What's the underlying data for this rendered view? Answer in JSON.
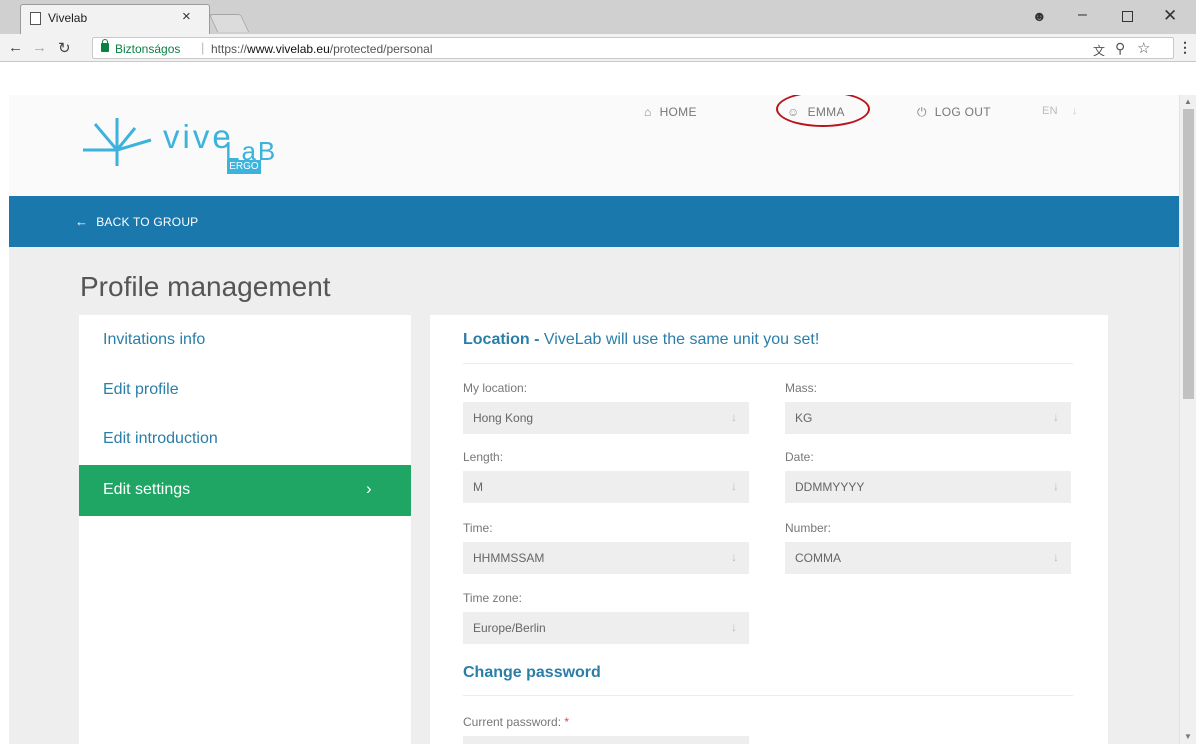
{
  "browser": {
    "tab_title": "Vivelab",
    "tab_close": "×",
    "secure_label": "Biztonságos",
    "url_prefix": "https://",
    "url_domain": "www.vivelab.eu",
    "url_path": "/protected/personal",
    "window_controls": {
      "minimize": "–",
      "close": "✕"
    }
  },
  "header": {
    "logo": {
      "text": "vive",
      "lab": "LaB",
      "badge": "ERGO"
    },
    "nav": {
      "home": "HOME",
      "user": "EMMA",
      "logout": "LOG OUT",
      "lang": "EN"
    }
  },
  "blue_bar": {
    "back_label": "BACK TO GROUP"
  },
  "page_title": "Profile management",
  "side_menu": {
    "items": [
      {
        "label": "Invitations info"
      },
      {
        "label": "Edit profile"
      },
      {
        "label": "Edit introduction"
      }
    ],
    "active": {
      "label": "Edit settings"
    }
  },
  "location_section": {
    "title_bold": "Location -",
    "title_rest": " ViveLab will use the same unit you set!"
  },
  "fields": {
    "my_location": {
      "label": "My location:",
      "value": "Hong Kong"
    },
    "mass": {
      "label": "Mass:",
      "value": "KG"
    },
    "length": {
      "label": "Length:",
      "value": "M"
    },
    "date": {
      "label": "Date:",
      "value": "DDMMYYYY"
    },
    "time": {
      "label": "Time:",
      "value": "HHMMSSAM"
    },
    "number": {
      "label": "Number:",
      "value": "COMMA"
    },
    "time_zone": {
      "label": "Time zone:",
      "value": "Europe/Berlin"
    }
  },
  "password_section": {
    "title": "Change password",
    "current_label": "Current password:",
    "required_mark": "*"
  },
  "colors": {
    "accent_blue": "#1b78ad",
    "active_green": "#1fa665",
    "link_blue": "#2a7ea8",
    "highlight_red": "#b8141b",
    "logo_cyan": "#3bb3dc"
  }
}
